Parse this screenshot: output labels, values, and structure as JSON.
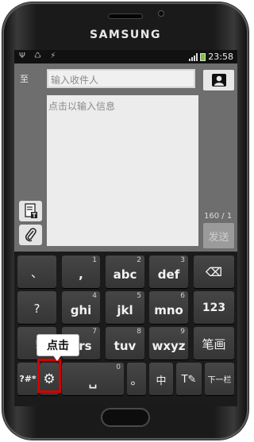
{
  "device": {
    "brand": "SAMSUNG"
  },
  "status_bar": {
    "left_icons": "Ψ ♺ ⚡",
    "time": "23:58"
  },
  "compose": {
    "to_label": "至",
    "recipient_placeholder": "输入收件人",
    "message_placeholder": "点击以输入信息",
    "char_counter": "160 / 1",
    "send_label": "发送"
  },
  "keyboard": {
    "rows": [
      [
        {
          "main": "、",
          "num": ""
        },
        {
          "main": ",",
          "num": "1"
        },
        {
          "main": "abc",
          "num": "2"
        },
        {
          "main": "def",
          "num": "3"
        },
        {
          "main": "⌫",
          "num": ""
        }
      ],
      [
        {
          "main": "?",
          "num": ""
        },
        {
          "main": "ghi",
          "num": "4"
        },
        {
          "main": "jkl",
          "num": "5"
        },
        {
          "main": "mno",
          "num": "6"
        },
        {
          "main": "123",
          "num": ""
        }
      ],
      [
        {
          "main": "!",
          "num": ""
        },
        {
          "main": "qrs",
          "num": "7"
        },
        {
          "main": "tuv",
          "num": "8"
        },
        {
          "main": "wxyz",
          "num": "9"
        },
        {
          "main": "笔画",
          "num": ""
        }
      ],
      [
        {
          "main": "?#*",
          "num": ""
        },
        {
          "main": "⚙",
          "num": ""
        },
        {
          "main": "␣",
          "num": "0"
        },
        {
          "main": "。",
          "num": ""
        },
        {
          "main": "中",
          "num": ""
        },
        {
          "main": "T✎",
          "num": ""
        },
        {
          "main": "下一栏",
          "num": ""
        }
      ]
    ]
  },
  "annotation": {
    "callout_text": "点击",
    "highlight_color": "#d40000"
  }
}
